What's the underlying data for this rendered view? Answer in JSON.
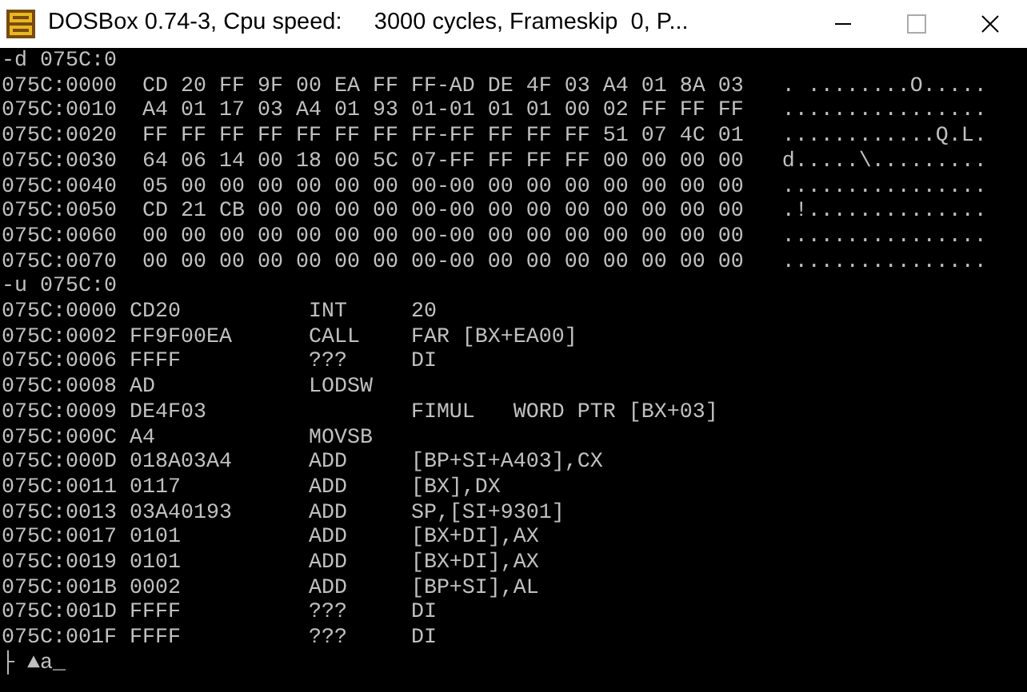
{
  "window": {
    "title": "DOSBox 0.74-3, Cpu speed:     3000 cycles, Frameskip  0, P..."
  },
  "console": {
    "lines": [
      "-d 075C:0",
      "075C:0000  CD 20 FF 9F 00 EA FF FF-AD DE 4F 03 A4 01 8A 03   . ........O.....",
      "075C:0010  A4 01 17 03 A4 01 93 01-01 01 01 00 02 FF FF FF   ................",
      "075C:0020  FF FF FF FF FF FF FF FF-FF FF FF FF 51 07 4C 01   ............Q.L.",
      "075C:0030  64 06 14 00 18 00 5C 07-FF FF FF FF 00 00 00 00   d.....\\.........",
      "075C:0040  05 00 00 00 00 00 00 00-00 00 00 00 00 00 00 00   ................",
      "075C:0050  CD 21 CB 00 00 00 00 00-00 00 00 00 00 00 00 00   .!..............",
      "075C:0060  00 00 00 00 00 00 00 00-00 00 00 00 00 00 00 00   ................",
      "075C:0070  00 00 00 00 00 00 00 00-00 00 00 00 00 00 00 00   ................",
      "-u 075C:0",
      "075C:0000 CD20          INT     20",
      "075C:0002 FF9F00EA      CALL    FAR [BX+EA00]",
      "075C:0006 FFFF          ???     DI",
      "075C:0008 AD            LODSW",
      "075C:0009 DE4F03                FIMUL   WORD PTR [BX+03]",
      "075C:000C A4            MOVSB",
      "075C:000D 018A03A4      ADD     [BP+SI+A403],CX",
      "075C:0011 0117          ADD     [BX],DX",
      "075C:0013 03A40193      ADD     SP,[SI+9301]",
      "075C:0017 0101          ADD     [BX+DI],AX",
      "075C:0019 0101          ADD     [BX+DI],AX",
      "075C:001B 0002          ADD     [BP+SI],AL",
      "075C:001D FFFF          ???     DI",
      "075C:001F FFFF          ???     DI",
      "├ ▲a_"
    ]
  }
}
